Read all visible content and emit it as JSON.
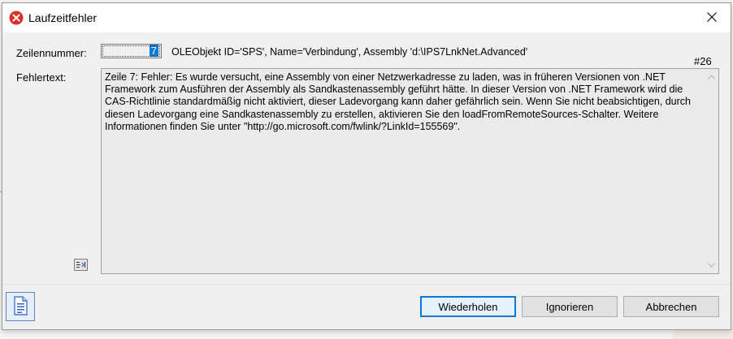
{
  "dialog": {
    "title": "Laufzeitfehler",
    "title_icon": "error-icon",
    "close_icon": "close-icon"
  },
  "line_number": {
    "label": "Zeilennummer:",
    "value": "7"
  },
  "object_info": "OLEObjekt ID='SPS', Name='Verbindung', Assembly 'd:\\IPS7LnkNet.Advanced'",
  "counter": "#26",
  "error": {
    "label": "Fehlertext:",
    "text": "Zeile 7: Fehler: Es wurde versucht, eine Assembly von einer Netzwerkadresse zu laden, was in früheren Versionen von .NET\nFramework zum Ausführen der Assembly als Sandkastenassembly geführt hätte. In dieser Version von .NET Framework wird die\nCAS-Richtlinie standardmäßig nicht aktiviert, dieser Ladevorgang kann daher gefährlich sein. Wenn Sie nicht beabsichtigen, durch\ndiesen Ladevorgang eine Sandkastenassembly zu erstellen, aktivieren Sie den loadFromRemoteSources-Schalter. Weitere\nInformationen finden Sie unter \"http://go.microsoft.com/fwlink/?LinkId=155569\"."
  },
  "buttons": {
    "retry": "Wiederholen",
    "ignore": "Ignorieren",
    "cancel": "Abbrechen"
  },
  "icons": {
    "wrap_toggle": "text-wrap-icon",
    "document": "document-icon"
  },
  "colors": {
    "accent": "#0078d7",
    "error_red": "#d93025"
  }
}
